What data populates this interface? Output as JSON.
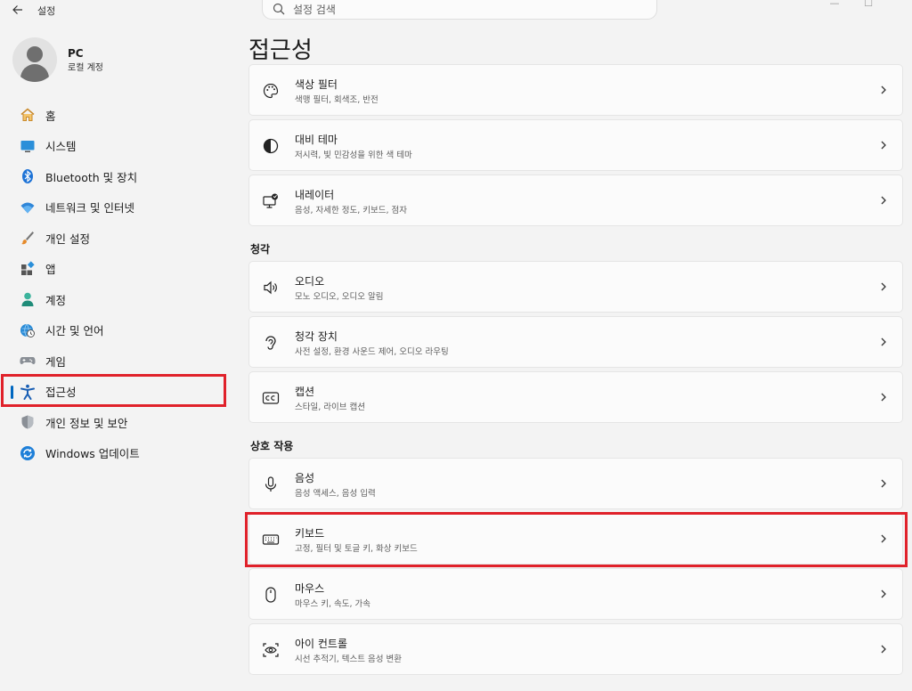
{
  "titlebar": {
    "app_title": "설정",
    "back_icon": "arrow-left-icon",
    "minimize": "—",
    "maximize": "☐"
  },
  "search": {
    "placeholder": "설정 검색",
    "value": ""
  },
  "profile": {
    "name": "PC",
    "account_type": "로컬 계정"
  },
  "sidebar": {
    "items": [
      {
        "label": "홈",
        "icon": "home-icon"
      },
      {
        "label": "시스템",
        "icon": "monitor-icon"
      },
      {
        "label": "Bluetooth 및 장치",
        "icon": "bluetooth-icon"
      },
      {
        "label": "네트워크 및 인터넷",
        "icon": "wifi-icon"
      },
      {
        "label": "개인 설정",
        "icon": "brush-icon"
      },
      {
        "label": "앱",
        "icon": "apps-icon"
      },
      {
        "label": "계정",
        "icon": "person-icon"
      },
      {
        "label": "시간 및 언어",
        "icon": "globe-clock-icon"
      },
      {
        "label": "게임",
        "icon": "gamepad-icon"
      },
      {
        "label": "접근성",
        "icon": "accessibility-icon",
        "selected": true
      },
      {
        "label": "개인 정보 및 보안",
        "icon": "shield-icon"
      },
      {
        "label": "Windows 업데이트",
        "icon": "update-icon"
      }
    ]
  },
  "main": {
    "title": "접근성",
    "vision_cards": [
      {
        "title": "색상 필터",
        "subtitle": "색맹 필터, 회색조, 반전",
        "icon": "palette-icon"
      },
      {
        "title": "대비 테마",
        "subtitle": "저시력, 빛 민감성을 위한 색 테마",
        "icon": "contrast-icon"
      },
      {
        "title": "내레이터",
        "subtitle": "음성, 자세한 정도, 키보드, 점자",
        "icon": "narrator-icon"
      }
    ],
    "hearing": {
      "label": "청각",
      "cards": [
        {
          "title": "오디오",
          "subtitle": "모노 오디오, 오디오 알림",
          "icon": "speaker-icon"
        },
        {
          "title": "청각 장치",
          "subtitle": "사전 설정, 환경 사운드 제어, 오디오 라우팅",
          "icon": "ear-icon"
        },
        {
          "title": "캡션",
          "subtitle": "스타일, 라이브 캡션",
          "icon": "cc-icon"
        }
      ]
    },
    "interaction": {
      "label": "상호 작용",
      "cards": [
        {
          "title": "음성",
          "subtitle": "음성 액세스, 음성 입력",
          "icon": "microphone-icon"
        },
        {
          "title": "키보드",
          "subtitle": "고정, 필터 및 토글 키, 화상 키보드",
          "icon": "keyboard-icon"
        },
        {
          "title": "마우스",
          "subtitle": "마우스 키, 속도, 가속",
          "icon": "mouse-icon"
        },
        {
          "title": "아이 컨트롤",
          "subtitle": "시선 추적기, 텍스트 음성 변환",
          "icon": "eye-control-icon"
        }
      ]
    }
  },
  "colors": {
    "highlight_box": "#e0212a",
    "accent": "#0067c0",
    "background": "#f3f3f3",
    "card": "#fbfbfb"
  }
}
